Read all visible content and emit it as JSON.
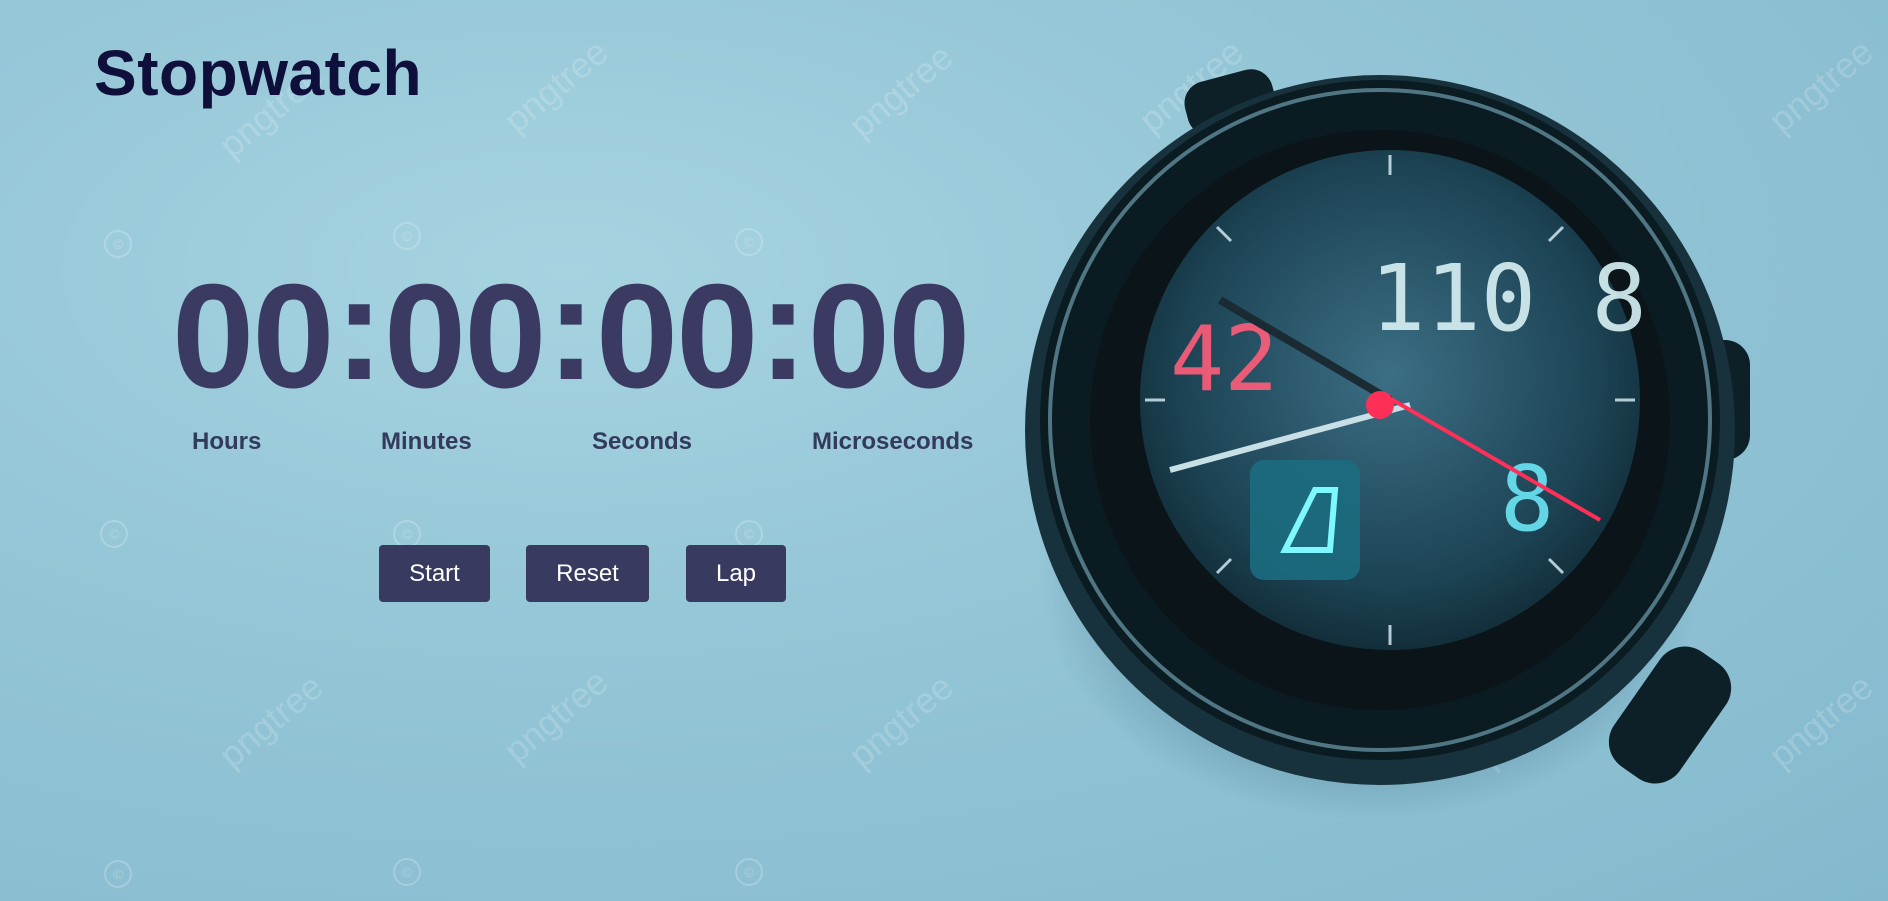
{
  "app": {
    "title": "Stopwatch"
  },
  "timer": {
    "hours": "00",
    "minutes": "00",
    "seconds": "00",
    "microseconds": "00",
    "separator": ":"
  },
  "labels": {
    "hours": "Hours",
    "minutes": "Minutes",
    "seconds": "Seconds",
    "microseconds": "Microseconds"
  },
  "controls": {
    "start_label": "Start",
    "reset_label": "Reset",
    "lap_label": "Lap"
  },
  "watermark": {
    "text": "pngtree"
  },
  "colors": {
    "background": "#93c5d6",
    "title": "#0e0f3a",
    "digits": "#3a3a63",
    "button": "#393a5f"
  },
  "icons": [
    "stopwatch-image"
  ]
}
